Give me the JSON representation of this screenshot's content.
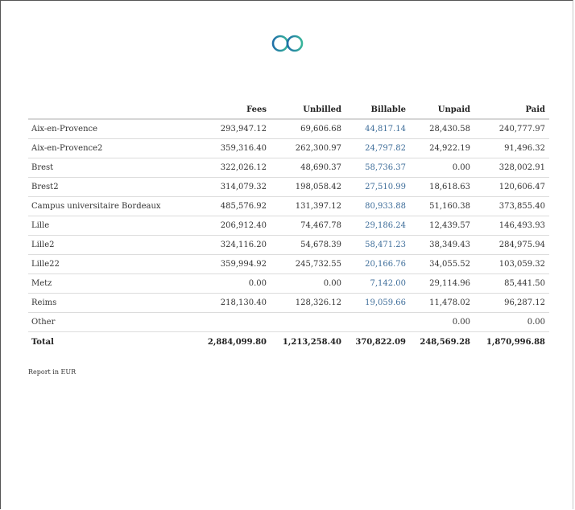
{
  "table": {
    "headers": [
      "",
      "Fees",
      "Unbilled",
      "Billable",
      "Unpaid",
      "Paid"
    ],
    "rows": [
      {
        "name": "Aix-en-Provence",
        "fees": "293,947.12",
        "unbilled": "69,606.68",
        "billable": "44,817.14",
        "unpaid": "28,430.58",
        "paid": "240,777.97"
      },
      {
        "name": "Aix-en-Provence2",
        "fees": "359,316.40",
        "unbilled": "262,300.97",
        "billable": "24,797.82",
        "unpaid": "24,922.19",
        "paid": "91,496.32"
      },
      {
        "name": "Brest",
        "fees": "322,026.12",
        "unbilled": "48,690.37",
        "billable": "58,736.37",
        "unpaid": "0.00",
        "paid": "328,002.91"
      },
      {
        "name": "Brest2",
        "fees": "314,079.32",
        "unbilled": "198,058.42",
        "billable": "27,510.99",
        "unpaid": "18,618.63",
        "paid": "120,606.47"
      },
      {
        "name": "Campus universitaire Bordeaux",
        "fees": "485,576.92",
        "unbilled": "131,397.12",
        "billable": "80,933.88",
        "unpaid": "51,160.38",
        "paid": "373,855.40"
      },
      {
        "name": "Lille",
        "fees": "206,912.40",
        "unbilled": "74,467.78",
        "billable": "29,186.24",
        "unpaid": "12,439.57",
        "paid": "146,493.93"
      },
      {
        "name": "Lille2",
        "fees": "324,116.20",
        "unbilled": "54,678.39",
        "billable": "58,471.23",
        "unpaid": "38,349.43",
        "paid": "284,975.94"
      },
      {
        "name": "Lille22",
        "fees": "359,994.92",
        "unbilled": "245,732.55",
        "billable": "20,166.76",
        "unpaid": "34,055.52",
        "paid": "103,059.32"
      },
      {
        "name": "Metz",
        "fees": "0.00",
        "unbilled": "0.00",
        "billable": "7,142.00",
        "unpaid": "29,114.96",
        "paid": "85,441.50"
      },
      {
        "name": "Reims",
        "fees": "218,130.40",
        "unbilled": "128,326.12",
        "billable": "19,059.66",
        "unpaid": "11,478.02",
        "paid": "96,287.12"
      },
      {
        "name": "Other",
        "fees": "",
        "unbilled": "",
        "billable": "",
        "unpaid": "0.00",
        "paid": "0.00"
      }
    ],
    "total": {
      "name": "Total",
      "fees": "2,884,099.80",
      "unbilled": "1,213,258.40",
      "billable": "370,822.09",
      "unpaid": "248,569.28",
      "paid": "1,870,996.88"
    }
  },
  "footer": {
    "note": "Report in EUR"
  },
  "colors": {
    "billable_link": "#3f6e9a",
    "logo_gradient_start": "#1f6fa8",
    "logo_gradient_end": "#38b59a"
  },
  "icons": {
    "logo": "infinity-logo-icon"
  }
}
